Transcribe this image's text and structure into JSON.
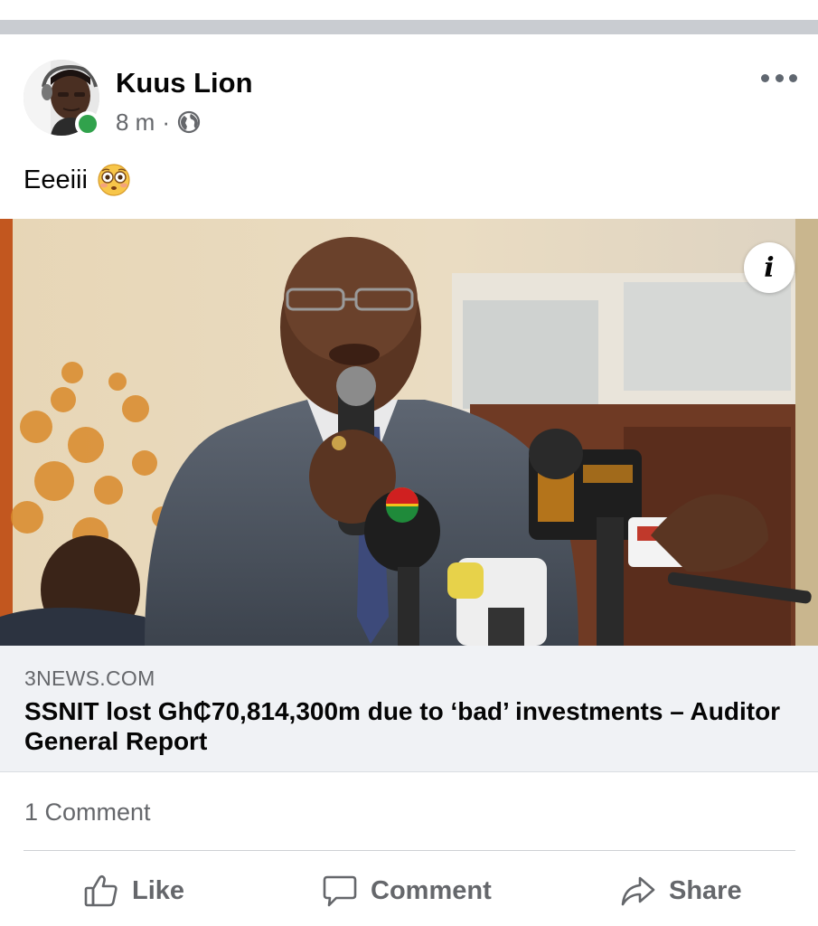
{
  "post": {
    "author": "Kuus Lion",
    "time": "8 m",
    "separator": "·",
    "privacy_icon": "globe-icon",
    "more_icon": "more-options-icon",
    "online": true,
    "text": "Eeeiii",
    "text_emoji": "flushed-face-emoji"
  },
  "link_preview": {
    "image_alt": "Speaker at a podium with microphones",
    "info_icon": "info-icon",
    "info_label": "i",
    "domain": "3NEWS.COM",
    "title": "SSNIT lost Gh₵70,814,300m due to ‘bad’ investments – Auditor General Report"
  },
  "footer": {
    "comment_count": "1 Comment",
    "actions": {
      "like": "Like",
      "comment": "Comment",
      "share": "Share"
    }
  },
  "colors": {
    "divider": "#c9ccd1",
    "online": "#31a24c",
    "secondary_text": "#65676b",
    "link_background": "#f0f2f5"
  }
}
